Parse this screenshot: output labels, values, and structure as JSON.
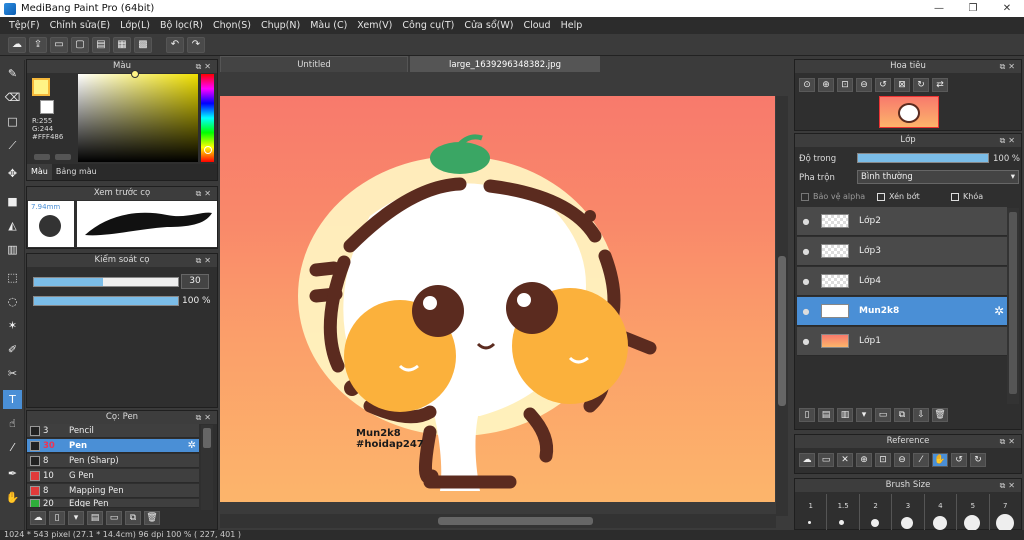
{
  "window": {
    "title": "MediBang Paint Pro (64bit)",
    "controls": [
      "—",
      "❐",
      "✕"
    ]
  },
  "menu": [
    "Tệp(F)",
    "Chỉnh sửa(E)",
    "Lớp(L)",
    "Bộ lọc(R)",
    "Chọn(S)",
    "Chụp(N)",
    "Màu (C)",
    "Xem(V)",
    "Công cụ(T)",
    "Cửa sổ(W)",
    "Cloud",
    "Help"
  ],
  "color_panel": {
    "title": "Màu",
    "r": "R:255",
    "g": "G:244",
    "hex": "#FFF486",
    "tab_color": "Màu",
    "tab_palette": "Bảng màu",
    "primary_color": "#FFF486",
    "secondary_color": "#FFFFFF"
  },
  "brush_preview": {
    "title": "Xem trước cọ",
    "size": "7.94mm"
  },
  "brush_control": {
    "title": "Kiểm soát cọ",
    "size_value": "30",
    "opacity_value": "100 %",
    "size_fraction": 0.48,
    "opacity_fraction": 1.0
  },
  "brush_list": {
    "title": "Cọ: Pen",
    "items": [
      {
        "size": "3",
        "name": "Pencil",
        "color": "#222222"
      },
      {
        "size": "30",
        "name": "Pen",
        "color": "#222222"
      },
      {
        "size": "8",
        "name": "Pen (Sharp)",
        "color": "#222222"
      },
      {
        "size": "10",
        "name": "G Pen",
        "color": "#e03a3a"
      },
      {
        "size": "8",
        "name": "Mapping Pen",
        "color": "#e03a3a"
      },
      {
        "size": "20",
        "name": "Edge Pen",
        "color": "#2eae3a"
      }
    ]
  },
  "tabs": [
    "Untitled",
    "large_1639296348382.jpg"
  ],
  "artwork": {
    "caption_line1": "Mun2k8",
    "caption_line2": "#hoidap247"
  },
  "navigator": {
    "title": "Hoa tiêu"
  },
  "layer_panel": {
    "title": "Lớp",
    "opacity_label": "Độ trong",
    "opacity_value": "100 %",
    "opacity_fraction": 1.0,
    "blend_label": "Pha trộn",
    "blend_value": "Bình thường",
    "protect_alpha": "Bảo vệ alpha",
    "clipping": "Xén bớt",
    "lock": "Khóa",
    "layers": [
      {
        "name": "Lớp2"
      },
      {
        "name": "Lớp3"
      },
      {
        "name": "Lớp4"
      },
      {
        "name": "Mun2k8"
      },
      {
        "name": "Lớp1"
      }
    ]
  },
  "reference_panel": {
    "title": "Reference"
  },
  "brush_size_panel": {
    "title": "Brush Size",
    "sizes": [
      "1",
      "1.5",
      "2",
      "3",
      "4",
      "5",
      "7"
    ]
  },
  "status": "1024 * 543 pixel  (27.1 * 14.4cm)  96 dpi  100 %  ( 227, 401 )"
}
